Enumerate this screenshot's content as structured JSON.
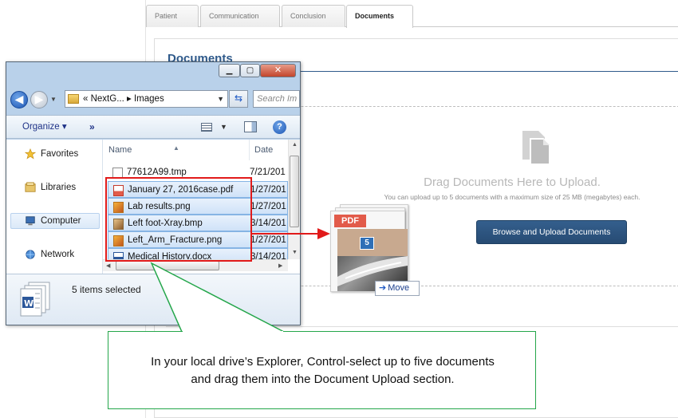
{
  "tabs": [
    {
      "label": "Patient",
      "active": false
    },
    {
      "label": "Communication",
      "active": false
    },
    {
      "label": "Conclusion",
      "active": false
    },
    {
      "label": "Documents",
      "active": true
    }
  ],
  "documents": {
    "section_title": "Documents",
    "drop_title": "Drag Documents Here to Upload.",
    "drop_subtitle": "You can upload up to 5 documents with a maximum size of 25 MB (megabytes) each.",
    "upload_button": "Browse and Upload Documents"
  },
  "drag_ghost": {
    "badge_text": "PDF",
    "count": "5",
    "move_label": "Move",
    "move_arrow": "➔"
  },
  "explorer": {
    "window_buttons": {
      "minimize": "▁",
      "maximize": "▢",
      "close": "✕"
    },
    "address": {
      "overflow": "«",
      "segment1": "NextG...",
      "separator": "▸",
      "segment2": "Images"
    },
    "search_placeholder": "Search Im",
    "toolbar": {
      "organize": "Organize ▾",
      "more": "»"
    },
    "nav": [
      {
        "label": "Favorites",
        "icon": "star-icon"
      },
      {
        "label": "Libraries",
        "icon": "libraries-icon"
      },
      {
        "label": "Computer",
        "icon": "computer-icon",
        "selected": true
      },
      {
        "label": "Network",
        "icon": "network-icon"
      }
    ],
    "columns": {
      "name": "Name",
      "date": "Date"
    },
    "files": [
      {
        "name": "77612A99.tmp",
        "date": "7/21/201",
        "selected": false,
        "icon": "tmp-file-icon"
      },
      {
        "name": "January 27, 2016case.pdf",
        "date": "1/27/201",
        "selected": true,
        "icon": "pdf-file-icon"
      },
      {
        "name": "Lab results.png",
        "date": "1/27/201",
        "selected": true,
        "icon": "png-file-icon"
      },
      {
        "name": "Left foot-Xray.bmp",
        "date": "3/14/201",
        "selected": true,
        "icon": "bmp-file-icon"
      },
      {
        "name": "Left_Arm_Fracture.png",
        "date": "1/27/201",
        "selected": true,
        "icon": "png-file-icon"
      },
      {
        "name": "Medical History.docx",
        "date": "3/14/201",
        "selected": true,
        "icon": "docx-file-icon"
      }
    ],
    "status": "5 items selected"
  },
  "callout": {
    "line1": "In your local drive’s Explorer, Control-select up to five documents",
    "line2": "and drag them into the Document Upload section."
  },
  "colors": {
    "accent": "#2f5a8b",
    "annotation_red": "#e11a1a",
    "callout_green": "#24a64a"
  }
}
